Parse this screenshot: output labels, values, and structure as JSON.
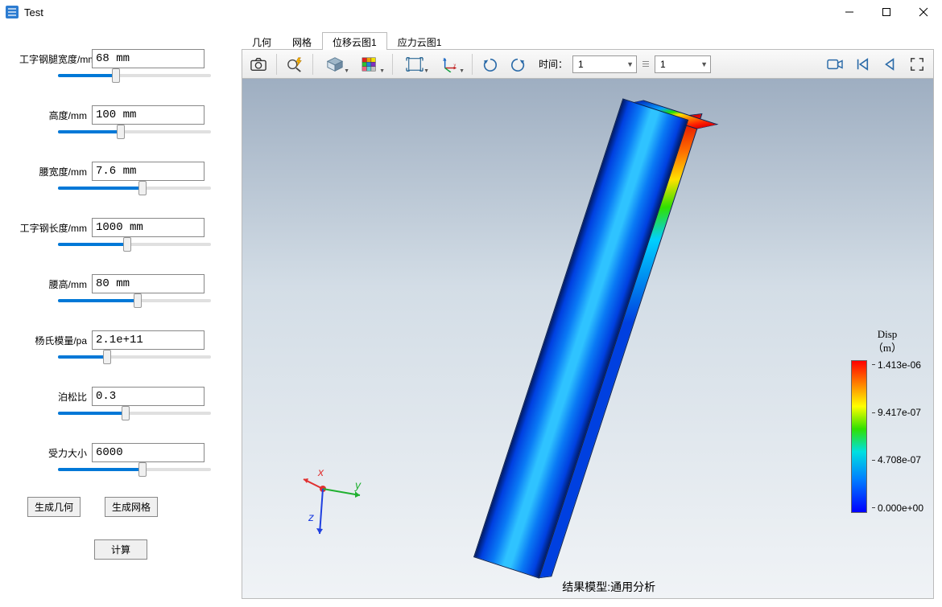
{
  "window": {
    "title": "Test"
  },
  "params": [
    {
      "label": "工字钢腿宽度/mm",
      "value": "68 mm",
      "slider_pct": 38
    },
    {
      "label": "高度/mm",
      "value": "100 mm",
      "slider_pct": 41
    },
    {
      "label": "腰宽度/mm",
      "value": "7.6 mm",
      "slider_pct": 55
    },
    {
      "label": "工字钢长度/mm",
      "value": "1000 mm",
      "slider_pct": 45
    },
    {
      "label": "腰高/mm",
      "value": "80 mm",
      "slider_pct": 52
    },
    {
      "label": "杨氏模量/pa",
      "value": "2.1e+11",
      "slider_pct": 32
    },
    {
      "label": "泊松比",
      "value": "0.3",
      "slider_pct": 44
    },
    {
      "label": "受力大小",
      "value": "6000",
      "slider_pct": 55
    }
  ],
  "buttons": {
    "gen_geom": "生成几何",
    "gen_mesh": "生成网格",
    "calculate": "计算"
  },
  "tabs": [
    {
      "label": "几何",
      "active": false
    },
    {
      "label": "网格",
      "active": false
    },
    {
      "label": "位移云图1",
      "active": true
    },
    {
      "label": "应力云图1",
      "active": false
    }
  ],
  "toolbar": {
    "time_label": "时间：",
    "time_value_1": "1",
    "time_value_2": "1"
  },
  "triad": {
    "x": "x",
    "y": "y",
    "z": "z"
  },
  "legend": {
    "title_line1": "Disp",
    "title_line2": "（m）",
    "ticks": [
      "1.413e-06",
      "9.417e-07",
      "4.708e-07",
      "0.000e+00"
    ]
  },
  "caption": "结果模型:通用分析",
  "chart_data": {
    "type": "heatmap",
    "title": "Disp (m)",
    "field": "Displacement magnitude",
    "units": "m",
    "colorbar_range": [
      0.0,
      1.413e-06
    ],
    "colorbar_ticks": [
      0.0,
      4.708e-07,
      9.417e-07,
      1.413e-06
    ],
    "model_caption": "结果模型:通用分析"
  }
}
